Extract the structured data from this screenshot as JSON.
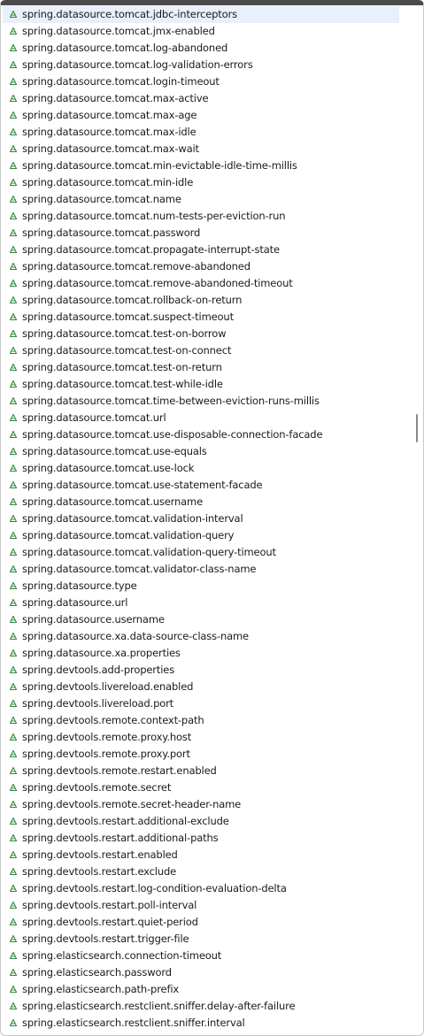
{
  "colors": {
    "icon_green": "#2e8b3a",
    "selected_bg": "#e8f0fb",
    "text": "#1a1a1a"
  },
  "icon": "property-triangle-icon",
  "items": [
    "spring.datasource.tomcat.jdbc-interceptors",
    "spring.datasource.tomcat.jmx-enabled",
    "spring.datasource.tomcat.log-abandoned",
    "spring.datasource.tomcat.log-validation-errors",
    "spring.datasource.tomcat.login-timeout",
    "spring.datasource.tomcat.max-active",
    "spring.datasource.tomcat.max-age",
    "spring.datasource.tomcat.max-idle",
    "spring.datasource.tomcat.max-wait",
    "spring.datasource.tomcat.min-evictable-idle-time-millis",
    "spring.datasource.tomcat.min-idle",
    "spring.datasource.tomcat.name",
    "spring.datasource.tomcat.num-tests-per-eviction-run",
    "spring.datasource.tomcat.password",
    "spring.datasource.tomcat.propagate-interrupt-state",
    "spring.datasource.tomcat.remove-abandoned",
    "spring.datasource.tomcat.remove-abandoned-timeout",
    "spring.datasource.tomcat.rollback-on-return",
    "spring.datasource.tomcat.suspect-timeout",
    "spring.datasource.tomcat.test-on-borrow",
    "spring.datasource.tomcat.test-on-connect",
    "spring.datasource.tomcat.test-on-return",
    "spring.datasource.tomcat.test-while-idle",
    "spring.datasource.tomcat.time-between-eviction-runs-millis",
    "spring.datasource.tomcat.url",
    "spring.datasource.tomcat.use-disposable-connection-facade",
    "spring.datasource.tomcat.use-equals",
    "spring.datasource.tomcat.use-lock",
    "spring.datasource.tomcat.use-statement-facade",
    "spring.datasource.tomcat.username",
    "spring.datasource.tomcat.validation-interval",
    "spring.datasource.tomcat.validation-query",
    "spring.datasource.tomcat.validation-query-timeout",
    "spring.datasource.tomcat.validator-class-name",
    "spring.datasource.type",
    "spring.datasource.url",
    "spring.datasource.username",
    "spring.datasource.xa.data-source-class-name",
    "spring.datasource.xa.properties",
    "spring.devtools.add-properties",
    "spring.devtools.livereload.enabled",
    "spring.devtools.livereload.port",
    "spring.devtools.remote.context-path",
    "spring.devtools.remote.proxy.host",
    "spring.devtools.remote.proxy.port",
    "spring.devtools.remote.restart.enabled",
    "spring.devtools.remote.secret",
    "spring.devtools.remote.secret-header-name",
    "spring.devtools.restart.additional-exclude",
    "spring.devtools.restart.additional-paths",
    "spring.devtools.restart.enabled",
    "spring.devtools.restart.exclude",
    "spring.devtools.restart.log-condition-evaluation-delta",
    "spring.devtools.restart.poll-interval",
    "spring.devtools.restart.quiet-period",
    "spring.devtools.restart.trigger-file",
    "spring.elasticsearch.connection-timeout",
    "spring.elasticsearch.password",
    "spring.elasticsearch.path-prefix",
    "spring.elasticsearch.restclient.sniffer.delay-after-failure",
    "spring.elasticsearch.restclient.sniffer.interval"
  ],
  "selected_index": 0
}
